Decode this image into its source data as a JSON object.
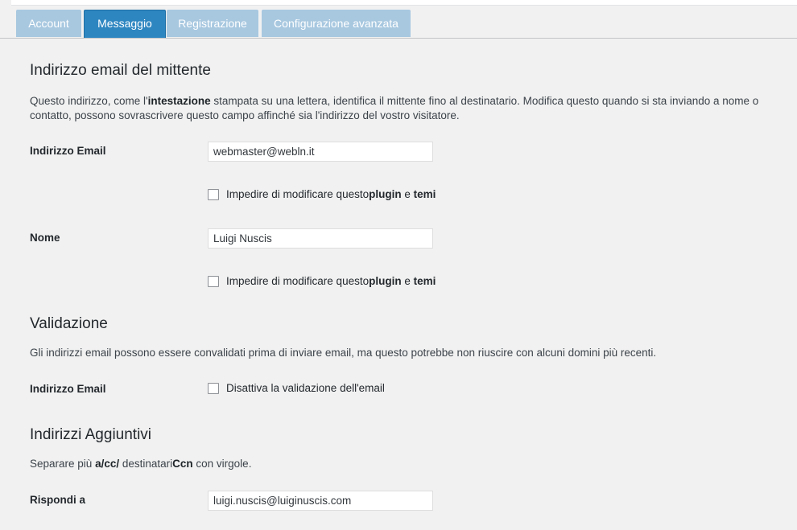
{
  "tabs": [
    {
      "label": "Account"
    },
    {
      "label": "Messaggio"
    },
    {
      "label": "Registrazione"
    },
    {
      "label": "Configurazione avanzata"
    }
  ],
  "sender": {
    "title": "Indirizzo email del mittente",
    "desc_line1_part1": "Questo indirizzo, come l'",
    "desc_line1_bold": "intestazione",
    "desc_line1_part2": " stampata su una lettera, identifica il mittente fino al destinatario. Modifica questo quando si sta inviando a nome o",
    "desc_line2": "contatto, possono sovrascrivere questo campo affinché sia l'indirizzo del vostro visitatore.",
    "email_label": "Indirizzo Email",
    "email_value": "webmaster@webln.it",
    "name_label": "Nome",
    "name_value": "Luigi Nuscis",
    "lock_text_part1": "Impedire di modificare questo ",
    "lock_text_bold1": "plugin",
    "lock_text_part2": " e ",
    "lock_text_bold2": "temi"
  },
  "validation": {
    "title": "Validazione",
    "desc": "Gli indirizzi email possono essere convalidati prima di inviare email, ma questo potrebbe non riuscire con alcuni domini più recenti.",
    "email_label": "Indirizzo Email",
    "checkbox_label": "Disattiva la validazione dell'email"
  },
  "additional": {
    "title": "Indirizzi Aggiuntivi",
    "desc_part1": "Separare più ",
    "desc_bold1": "a/cc/",
    "desc_part2": " destinatari",
    "desc_bold2": "Ccn",
    "desc_part3": " con virgole.",
    "reply_label": "Rispondi a",
    "reply_value": "luigi.nuscis@luiginuscis.com"
  }
}
